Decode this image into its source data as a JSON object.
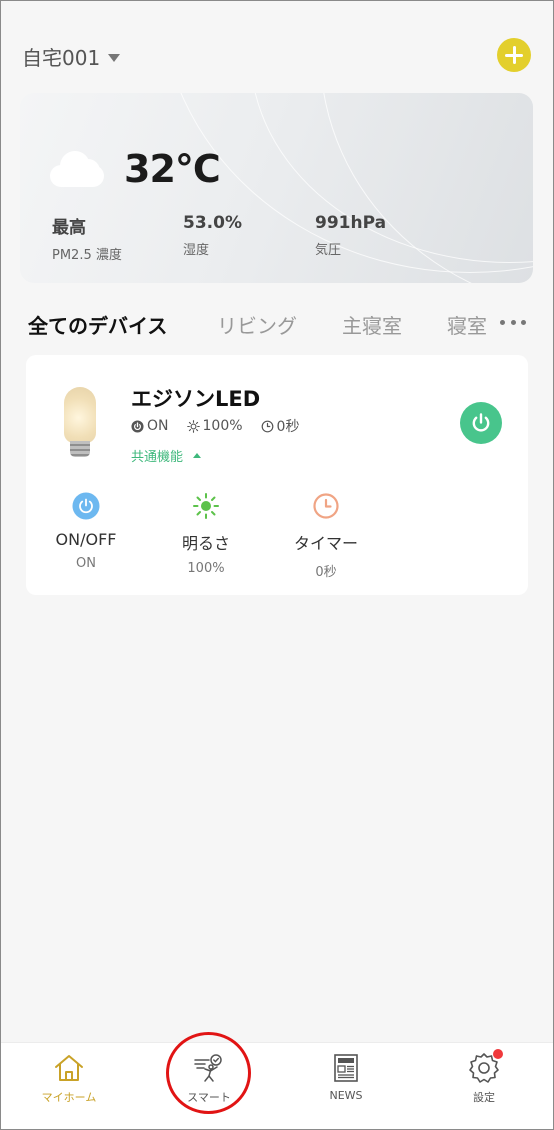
{
  "header": {
    "home_name": "自宅001"
  },
  "weather": {
    "temperature": "32°C",
    "stats": [
      {
        "value": "最高",
        "label": "PM2.5 濃度"
      },
      {
        "value": "53.0%",
        "label": "湿度"
      },
      {
        "value": "991hPa",
        "label": "気圧"
      }
    ]
  },
  "rooms": {
    "tabs": [
      "全てのデバイス",
      "リビング",
      "主寝室",
      "寝室"
    ],
    "active_index": 0
  },
  "device": {
    "name": "エジソンLED",
    "status": {
      "power": "ON",
      "brightness": "100%",
      "timer": "0秒"
    },
    "common_functions_label": "共通機能",
    "functions": [
      {
        "label": "ON/OFF",
        "value": "ON",
        "icon": "power-icon",
        "color": "#6db8f0"
      },
      {
        "label": "明るさ",
        "value": "100%",
        "icon": "sun-icon",
        "color": "#5cc24a"
      },
      {
        "label": "タイマー",
        "value": "0秒",
        "icon": "clock-icon",
        "color": "#f0a484"
      }
    ],
    "power_button_color": "#48c58c"
  },
  "bottom_nav": {
    "items": [
      {
        "label": "マイホーム",
        "icon": "home-icon",
        "active": true
      },
      {
        "label": "スマート",
        "icon": "smart-scene-icon",
        "active": false
      },
      {
        "label": "NEWS",
        "icon": "news-icon",
        "active": false
      },
      {
        "label": "設定",
        "icon": "settings-gear-icon",
        "active": false,
        "has_notification": true
      }
    ]
  },
  "colors": {
    "accent_yellow": "#e3cf2c",
    "active_nav": "#c9a227",
    "green": "#48c58c",
    "highlight_ring": "#e11414"
  }
}
